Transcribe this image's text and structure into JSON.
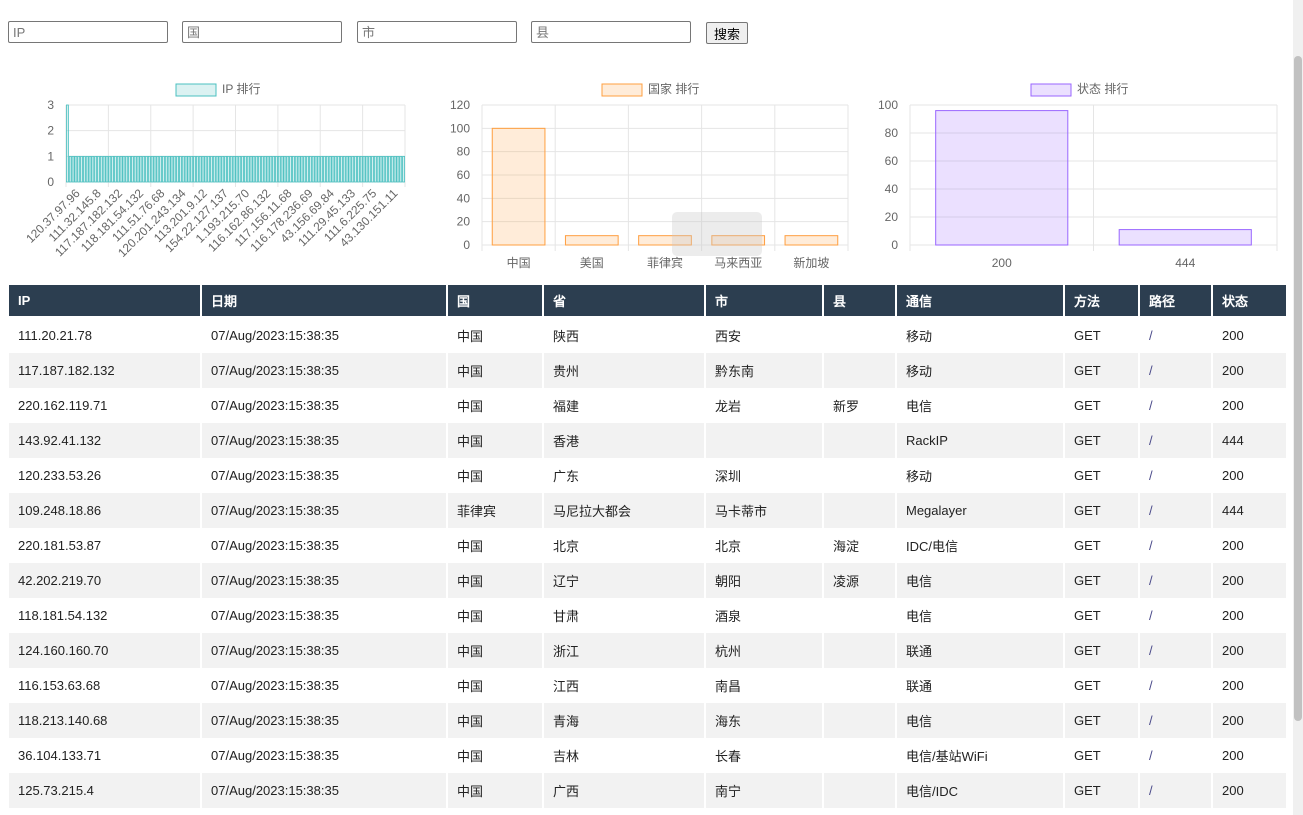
{
  "search": {
    "ip_placeholder": "IP",
    "country_placeholder": "国",
    "city_placeholder": "市",
    "county_placeholder": "县",
    "button_label": "搜索"
  },
  "colors": {
    "ip_chart": "#4bc0c0",
    "country_chart": "#ff9f40",
    "status_chart": "#9966ff",
    "table_header": "#2c3e50"
  },
  "chart_data": [
    {
      "type": "bar",
      "legend": "IP 排行",
      "categories": [
        "120.37.97.96",
        "111.32.145.8",
        "117.187.182.132",
        "118.181.54.132",
        "111.51.76.68",
        "120.201.243.134",
        "113.201.9.12",
        "154.22.127.137",
        "1.193.215.70",
        "116.162.86.132",
        "117.156.11.68",
        "116.178.236.69",
        "43.156.69.84",
        "111.29.45.133",
        "111.6.225.75",
        "43.130.151.11"
      ],
      "bars_total": 120,
      "values_note": "",
      "values": [
        3,
        1,
        1,
        1,
        1,
        1,
        1,
        1,
        1,
        1,
        1,
        1,
        1,
        1,
        1,
        1
      ],
      "ylim": [
        0,
        3
      ],
      "yticks": [
        0,
        1,
        2,
        3
      ]
    },
    {
      "type": "bar",
      "legend": "国家 排行",
      "categories": [
        "中国",
        "美国",
        "菲律宾",
        "马来西亚",
        "新加坡"
      ],
      "values": [
        100,
        8,
        8,
        8,
        8
      ],
      "ylim": [
        0,
        120
      ],
      "yticks": [
        0,
        20,
        40,
        60,
        80,
        100,
        120
      ]
    },
    {
      "type": "bar",
      "legend": "状态 排行",
      "categories": [
        "200",
        "444"
      ],
      "values": [
        96,
        11
      ],
      "ylim": [
        0,
        100
      ],
      "yticks": [
        0,
        20,
        40,
        60,
        80,
        100
      ]
    }
  ],
  "table": {
    "headers": [
      "IP",
      "日期",
      "国",
      "省",
      "市",
      "县",
      "通信",
      "方法",
      "路径",
      "状态"
    ],
    "rows": [
      [
        "111.20.21.78",
        "07/Aug/2023:15:38:35",
        "中国",
        "陕西",
        "西安",
        "",
        "移动",
        "GET",
        "/",
        "200"
      ],
      [
        "117.187.182.132",
        "07/Aug/2023:15:38:35",
        "中国",
        "贵州",
        "黔东南",
        "",
        "移动",
        "GET",
        "/",
        "200"
      ],
      [
        "220.162.119.71",
        "07/Aug/2023:15:38:35",
        "中国",
        "福建",
        "龙岩",
        "新罗",
        "电信",
        "GET",
        "/",
        "200"
      ],
      [
        "143.92.41.132",
        "07/Aug/2023:15:38:35",
        "中国",
        "香港",
        "",
        "",
        "RackIP",
        "GET",
        "/",
        "444"
      ],
      [
        "120.233.53.26",
        "07/Aug/2023:15:38:35",
        "中国",
        "广东",
        "深圳",
        "",
        "移动",
        "GET",
        "/",
        "200"
      ],
      [
        "109.248.18.86",
        "07/Aug/2023:15:38:35",
        "菲律宾",
        "马尼拉大都会",
        "马卡蒂市",
        "",
        "Megalayer",
        "GET",
        "/",
        "444"
      ],
      [
        "220.181.53.87",
        "07/Aug/2023:15:38:35",
        "中国",
        "北京",
        "北京",
        "海淀",
        "IDC/电信",
        "GET",
        "/",
        "200"
      ],
      [
        "42.202.219.70",
        "07/Aug/2023:15:38:35",
        "中国",
        "辽宁",
        "朝阳",
        "凌源",
        "电信",
        "GET",
        "/",
        "200"
      ],
      [
        "118.181.54.132",
        "07/Aug/2023:15:38:35",
        "中国",
        "甘肃",
        "酒泉",
        "",
        "电信",
        "GET",
        "/",
        "200"
      ],
      [
        "124.160.160.70",
        "07/Aug/2023:15:38:35",
        "中国",
        "浙江",
        "杭州",
        "",
        "联通",
        "GET",
        "/",
        "200"
      ],
      [
        "116.153.63.68",
        "07/Aug/2023:15:38:35",
        "中国",
        "江西",
        "南昌",
        "",
        "联通",
        "GET",
        "/",
        "200"
      ],
      [
        "118.213.140.68",
        "07/Aug/2023:15:38:35",
        "中国",
        "青海",
        "海东",
        "",
        "电信",
        "GET",
        "/",
        "200"
      ],
      [
        "36.104.133.71",
        "07/Aug/2023:15:38:35",
        "中国",
        "吉林",
        "长春",
        "",
        "电信/基站WiFi",
        "GET",
        "/",
        "200"
      ],
      [
        "125.73.215.4",
        "07/Aug/2023:15:38:35",
        "中国",
        "广西",
        "南宁",
        "",
        "电信/IDC",
        "GET",
        "/",
        "200"
      ]
    ]
  }
}
